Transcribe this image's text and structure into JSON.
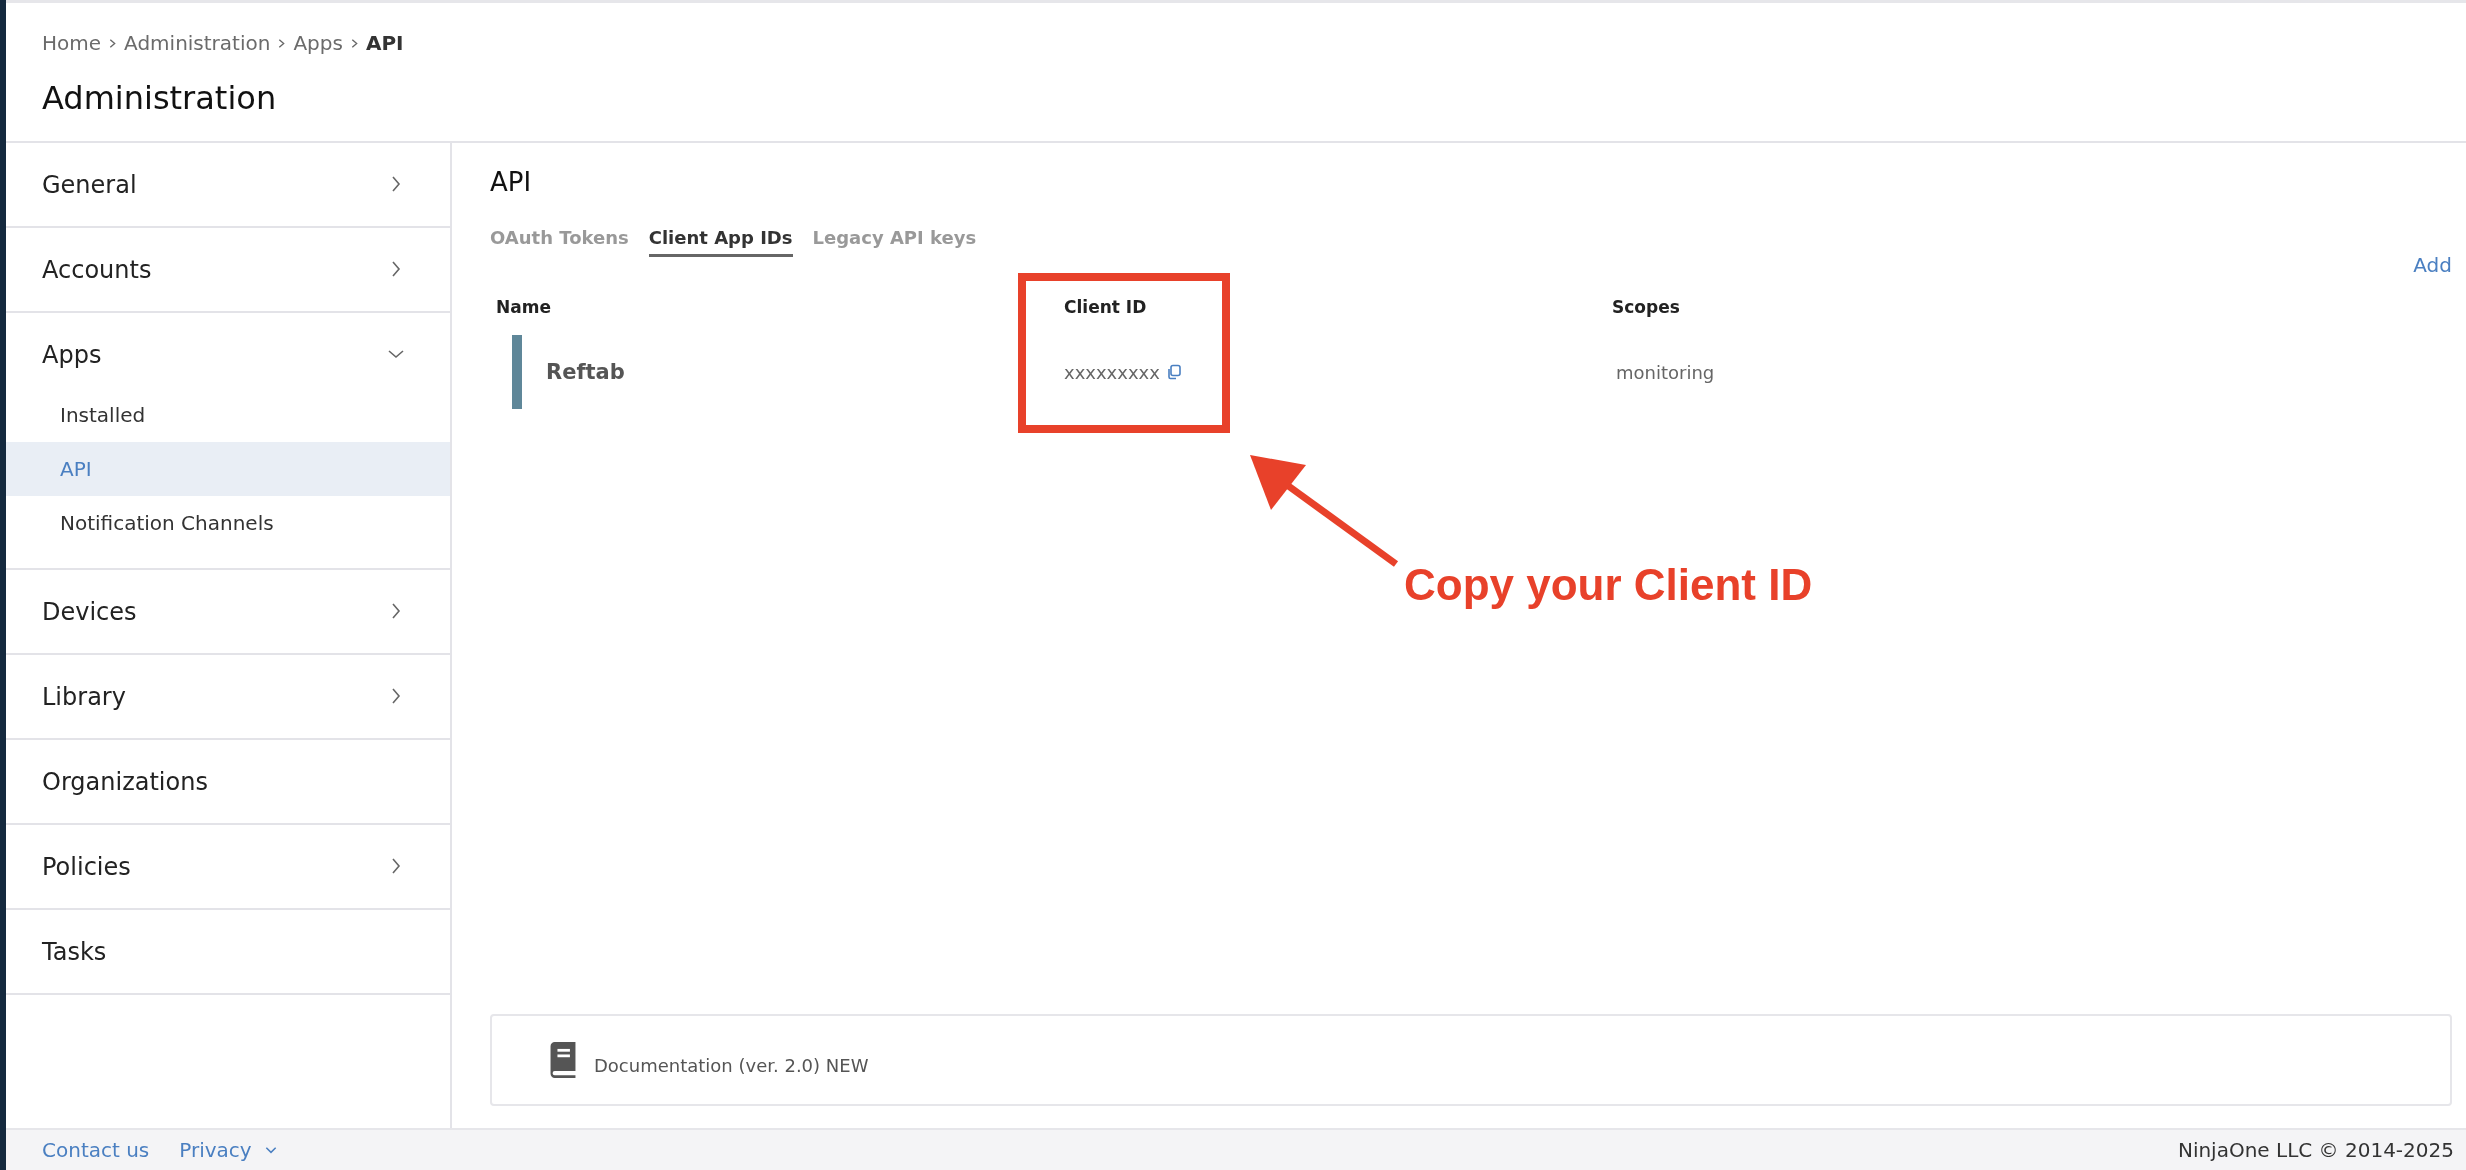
{
  "breadcrumb": [
    {
      "label": "Home",
      "current": false
    },
    {
      "label": "Administration",
      "current": false
    },
    {
      "label": "Apps",
      "current": false
    },
    {
      "label": "API",
      "current": true
    }
  ],
  "page_title": "Administration",
  "sidebar": {
    "items": [
      {
        "label": "General",
        "kind": "group",
        "expanded": false
      },
      {
        "label": "Accounts",
        "kind": "group",
        "expanded": false
      },
      {
        "label": "Apps",
        "kind": "group",
        "expanded": true,
        "children": [
          {
            "label": "Installed",
            "selected": false
          },
          {
            "label": "API",
            "selected": true
          },
          {
            "label": "Notification Channels",
            "selected": false
          }
        ]
      },
      {
        "label": "Devices",
        "kind": "group",
        "expanded": false
      },
      {
        "label": "Library",
        "kind": "group",
        "expanded": false
      },
      {
        "label": "Organizations",
        "kind": "link"
      },
      {
        "label": "Policies",
        "kind": "group",
        "expanded": false
      },
      {
        "label": "Tasks",
        "kind": "link"
      }
    ]
  },
  "section_title": "API",
  "tabs": [
    {
      "label": "OAuth Tokens",
      "selected": false
    },
    {
      "label": "Client App IDs",
      "selected": true
    },
    {
      "label": "Legacy API keys",
      "selected": false
    }
  ],
  "add_link": "Add",
  "table": {
    "columns": [
      "Name",
      "Client ID",
      "Scopes"
    ],
    "rows": [
      {
        "name": "Reftab",
        "client_id": "xxxxxxxxx",
        "scopes": "monitoring"
      }
    ]
  },
  "documentation_link": "Documentation (ver. 2.0) NEW",
  "annotation": {
    "text": "Copy your Client ID"
  },
  "footer": {
    "links": [
      {
        "label": "Contact us",
        "dropdown": false
      },
      {
        "label": "Privacy",
        "dropdown": true
      }
    ],
    "copyright": "NinjaOne LLC © 2014-2025"
  }
}
